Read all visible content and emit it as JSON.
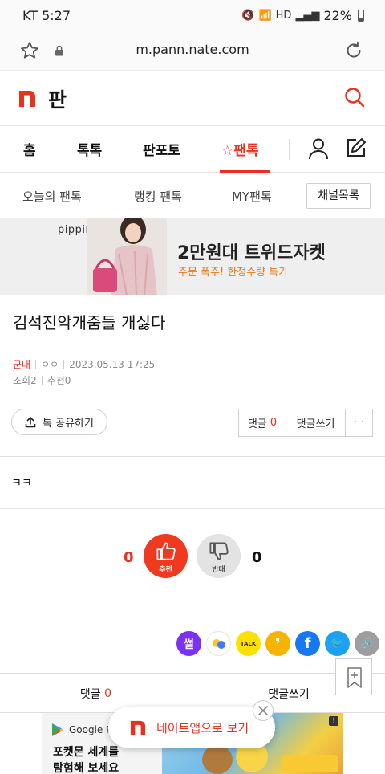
{
  "status_bar": {
    "carrier_time": "KT 5:27",
    "battery": "22%"
  },
  "browser": {
    "url": "m.pann.nate.com"
  },
  "header": {
    "logo_text": "판"
  },
  "main_nav": {
    "items": [
      {
        "label": "홈"
      },
      {
        "label": "톡톡"
      },
      {
        "label": "판포토"
      },
      {
        "label": "☆팬톡",
        "active": true
      }
    ]
  },
  "sub_nav": {
    "items": [
      {
        "label": "오늘의 팬톡"
      },
      {
        "label": "랭킹 팬톡"
      },
      {
        "label": "MY팬톡"
      }
    ],
    "channel_button": "채널목록"
  },
  "ad_banner": {
    "brand": "pippin.",
    "headline": "2만원대 트위드자켓",
    "subline": "주문 폭주! 한정수량 특가"
  },
  "post": {
    "title": "김석진악개줌들 개싫다",
    "category": "군대",
    "author": "ㅇㅇ",
    "date": "2023.05.13 17:25",
    "views": "조회2",
    "recommends": "추천0",
    "body": "ㅋㅋ"
  },
  "actions": {
    "share_label": "톡 공유하기",
    "comment_label": "댓글",
    "comment_count": "0",
    "write_comment_label": "댓글쓰기",
    "more_label": "···"
  },
  "votes": {
    "up_count": "0",
    "up_label": "추천",
    "down_count": "0",
    "down_label": "반대"
  },
  "sns": [
    {
      "icon": "ssul-icon",
      "text": "썰",
      "color": "#7b2ff7"
    },
    {
      "icon": "band-icon",
      "text": "",
      "color": "#ffffff"
    },
    {
      "icon": "kakaotalk-icon",
      "text": "TALK",
      "color": "#fae100"
    },
    {
      "icon": "kakaostory-icon",
      "text": "❜",
      "color": "#f5b400"
    },
    {
      "icon": "facebook-icon",
      "text": "f",
      "color": "#1877f2"
    },
    {
      "icon": "twitter-icon",
      "text": "🐦",
      "color": "#1da1f2"
    },
    {
      "icon": "link-icon",
      "text": "🔗",
      "color": "#9e9e9e"
    }
  ],
  "bottom_bar": {
    "comment_label": "댓글",
    "comment_count": "0",
    "write_comment_label": "댓글쓰기"
  },
  "bottom_ad": {
    "source": "Google Pl",
    "title": "포켓몬 세계를",
    "subtitle": "탐험해 보세요"
  },
  "app_popup": {
    "label": "네이트앱으로 보기"
  },
  "colors": {
    "accent": "#e8321f",
    "vote_up": "#ef3a1f"
  }
}
